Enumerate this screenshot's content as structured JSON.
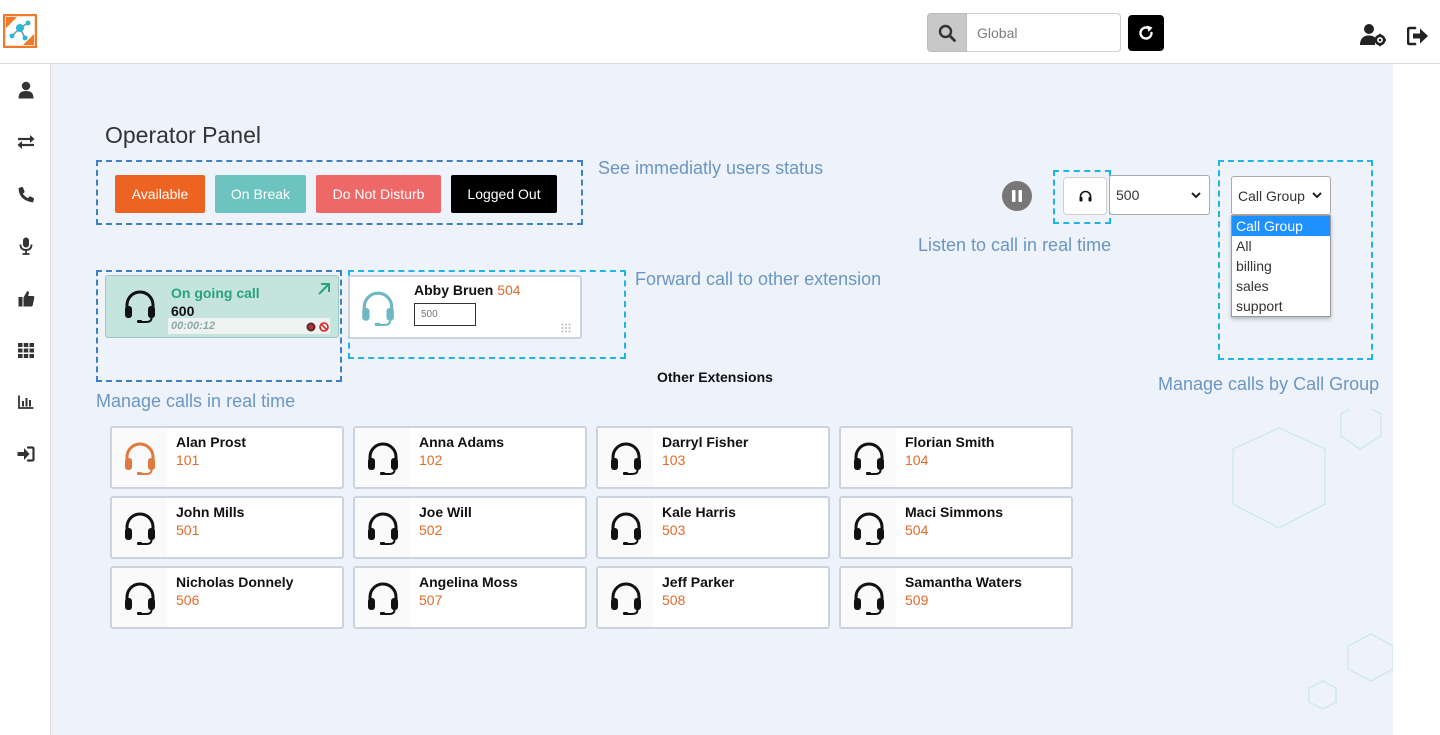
{
  "header": {
    "search": {
      "placeholder": "Global",
      "value": ""
    }
  },
  "sidebar": {
    "items": [
      {
        "icon": "user-icon"
      },
      {
        "icon": "transfer-arrows-icon"
      },
      {
        "icon": "phone-icon"
      },
      {
        "icon": "microphone-icon"
      },
      {
        "icon": "thumbs-up-icon"
      },
      {
        "icon": "grid-icon"
      },
      {
        "icon": "bar-chart-icon"
      },
      {
        "icon": "sign-in-icon"
      }
    ]
  },
  "page": {
    "title": "Operator Panel"
  },
  "status_buttons": [
    {
      "label": "Available",
      "color": "#ec6322"
    },
    {
      "label": "On Break",
      "color": "#6cc3bf"
    },
    {
      "label": "Do Not Disturb",
      "color": "#ee6868"
    },
    {
      "label": "Logged Out",
      "color": "#000000"
    }
  ],
  "annotations": {
    "users_status": "See immediatly users status",
    "listen": "Listen to call in real time",
    "forward": "Forward call to other extension",
    "manage_realtime": "Manage calls in real time",
    "manage_group": "Manage calls by Call Group"
  },
  "controls": {
    "extension_select": {
      "value": "500"
    },
    "call_group_select": {
      "value": "Call Group"
    },
    "call_group_options": [
      "Call Group",
      "All",
      "billing",
      "sales",
      "support"
    ],
    "call_group_selected_index": 0
  },
  "ongoing_call": {
    "label": "On going call",
    "number": "600",
    "timer": "00:00:12"
  },
  "forward_card": {
    "name": "Abby Bruen",
    "ext": "504",
    "input_placeholder": "500"
  },
  "other_extensions": {
    "title": "Other Extensions",
    "items": [
      {
        "name": "Alan Prost",
        "ext": "101",
        "active": true
      },
      {
        "name": "Anna Adams",
        "ext": "102",
        "active": false
      },
      {
        "name": "Darryl Fisher",
        "ext": "103",
        "active": false
      },
      {
        "name": "Florian Smith",
        "ext": "104",
        "active": false
      },
      {
        "name": "John Mills",
        "ext": "501",
        "active": false
      },
      {
        "name": "Joe Will",
        "ext": "502",
        "active": false
      },
      {
        "name": "Kale Harris",
        "ext": "503",
        "active": false
      },
      {
        "name": "Maci Simmons",
        "ext": "504",
        "active": false
      },
      {
        "name": "Nicholas Donnely",
        "ext": "506",
        "active": false
      },
      {
        "name": "Angelina Moss",
        "ext": "507",
        "active": false
      },
      {
        "name": "Jeff Parker",
        "ext": "508",
        "active": false
      },
      {
        "name": "Samantha Waters",
        "ext": "509",
        "active": false
      }
    ]
  },
  "colors": {
    "accent_orange": "#e36b2a",
    "annotation_blue": "#6b96c4",
    "dashed_blue": "#3f7fc5",
    "dashed_cyan": "#1eb5e6",
    "ongoing_green": "#2aa37b",
    "background": "#eef3fb"
  }
}
